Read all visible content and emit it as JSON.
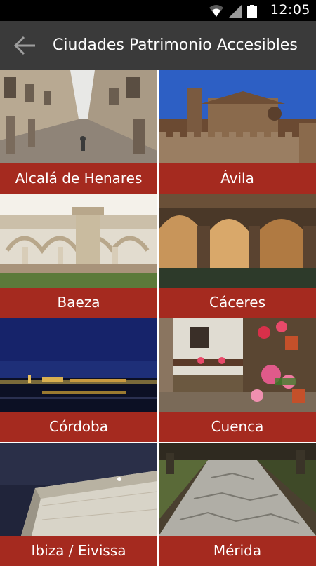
{
  "status_bar": {
    "time": "12:05",
    "icons": [
      "wifi-icon",
      "cell-signal-icon",
      "battery-icon"
    ]
  },
  "action_bar": {
    "title": "Ciudades Patrimonio Accesibles",
    "back_icon": "arrow-left-icon"
  },
  "colors": {
    "label_bg": "#a52a1f",
    "action_bar_bg": "#3a3a3a",
    "status_bar_bg": "#000000"
  },
  "cities": [
    {
      "name": "Alcalá de Henares",
      "image": "street-arcade-photo"
    },
    {
      "name": "Ávila",
      "image": "walled-cathedral-photo"
    },
    {
      "name": "Baeza",
      "image": "cloister-columns-photo"
    },
    {
      "name": "Cáceres",
      "image": "cistern-arches-photo"
    },
    {
      "name": "Córdoba",
      "image": "night-bridge-photo"
    },
    {
      "name": "Cuenca",
      "image": "flower-balcony-alley-photo"
    },
    {
      "name": "Ibiza / Eivissa",
      "image": "sea-fortress-photo"
    },
    {
      "name": "Mérida",
      "image": "roman-road-photo"
    }
  ]
}
